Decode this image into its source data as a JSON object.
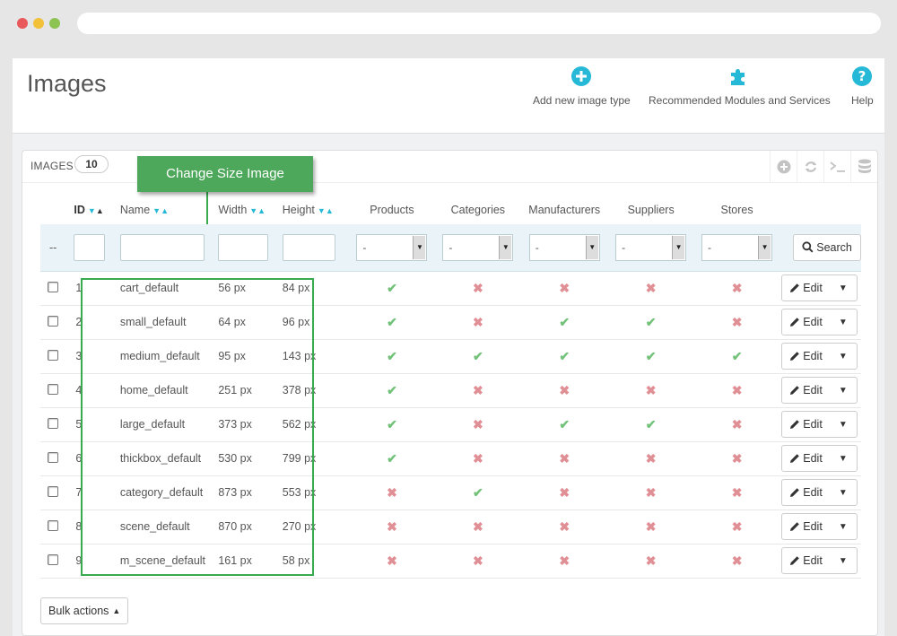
{
  "header": {
    "title": "Images",
    "toolbar": [
      {
        "label": "Add new image type",
        "icon": "plus-circle-icon"
      },
      {
        "label": "Recommended Modules and Services",
        "icon": "puzzle-icon"
      },
      {
        "label": "Help",
        "icon": "help-icon"
      }
    ]
  },
  "panel": {
    "title": "Images",
    "count": "10",
    "callout": "Change Size Image",
    "heading_icons": [
      "add-icon",
      "refresh-icon",
      "terminal-icon",
      "database-icon"
    ]
  },
  "table": {
    "columns": [
      "ID",
      "Name",
      "Width",
      "Height",
      "Products",
      "Categories",
      "Manufacturers",
      "Suppliers",
      "Stores"
    ],
    "filter_placeholder": "--",
    "select_value": "-",
    "search_label": "Search",
    "edit_label": "Edit",
    "rows": [
      {
        "id": "1",
        "name": "cart_default",
        "width": "56 px",
        "height": "84 px",
        "flags": [
          true,
          false,
          false,
          false,
          false
        ]
      },
      {
        "id": "2",
        "name": "small_default",
        "width": "64 px",
        "height": "96 px",
        "flags": [
          true,
          false,
          true,
          true,
          false
        ]
      },
      {
        "id": "3",
        "name": "medium_default",
        "width": "95 px",
        "height": "143 px",
        "flags": [
          true,
          true,
          true,
          true,
          true
        ]
      },
      {
        "id": "4",
        "name": "home_default",
        "width": "251 px",
        "height": "378 px",
        "flags": [
          true,
          false,
          false,
          false,
          false
        ]
      },
      {
        "id": "5",
        "name": "large_default",
        "width": "373 px",
        "height": "562 px",
        "flags": [
          true,
          false,
          true,
          true,
          false
        ]
      },
      {
        "id": "6",
        "name": "thickbox_default",
        "width": "530 px",
        "height": "799 px",
        "flags": [
          true,
          false,
          false,
          false,
          false
        ]
      },
      {
        "id": "7",
        "name": "category_default",
        "width": "873 px",
        "height": "553 px",
        "flags": [
          false,
          true,
          false,
          false,
          false
        ]
      },
      {
        "id": "8",
        "name": "scene_default",
        "width": "870 px",
        "height": "270 px",
        "flags": [
          false,
          false,
          false,
          false,
          false
        ]
      },
      {
        "id": "9",
        "name": "m_scene_default",
        "width": "161 px",
        "height": "58 px",
        "flags": [
          false,
          false,
          false,
          false,
          false
        ]
      }
    ]
  },
  "footer": {
    "bulk_label": "Bulk actions"
  },
  "colors": {
    "accent": "#25b9d7",
    "yes": "#72c279",
    "no": "#e08f95",
    "callout": "#4da85b"
  }
}
